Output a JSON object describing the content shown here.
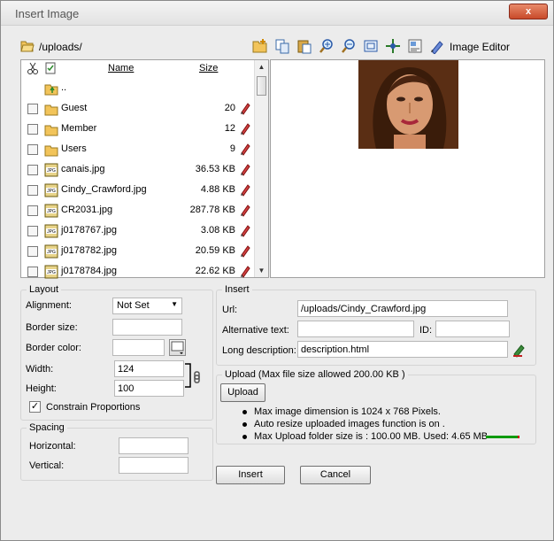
{
  "window": {
    "title": "Insert Image",
    "close_label": "x"
  },
  "path": {
    "current": "/uploads/"
  },
  "toolbar": {
    "icons": [
      "new-folder-icon",
      "copy-icon",
      "paste-icon",
      "zoom-in-icon",
      "zoom-out-icon",
      "actual-size-icon",
      "fit-icon",
      "properties-icon",
      "image-editor-icon"
    ],
    "image_editor_label": "Image Editor"
  },
  "file_list": {
    "header": {
      "name": "Name",
      "size": "Size"
    },
    "parent": "..",
    "rows": [
      {
        "name": "Guest",
        "size": "20",
        "type": "folder"
      },
      {
        "name": "Member",
        "size": "12",
        "type": "folder"
      },
      {
        "name": "Users",
        "size": "9",
        "type": "folder"
      },
      {
        "name": "canais.jpg",
        "size": "36.53 KB",
        "type": "jpg"
      },
      {
        "name": "Cindy_Crawford.jpg",
        "size": "4.88 KB",
        "type": "jpg"
      },
      {
        "name": "CR2031.jpg",
        "size": "287.78 KB",
        "type": "jpg"
      },
      {
        "name": "j0178767.jpg",
        "size": "3.08 KB",
        "type": "jpg"
      },
      {
        "name": "j0178782.jpg",
        "size": "20.59 KB",
        "type": "jpg"
      },
      {
        "name": "j0178784.jpg",
        "size": "22.62 KB",
        "type": "jpg"
      }
    ]
  },
  "layout": {
    "legend": "Layout",
    "alignment_label": "Alignment:",
    "alignment_value": "Not Set",
    "border_size_label": "Border size:",
    "border_size_value": "",
    "border_color_label": "Border color:",
    "border_color_value": "",
    "width_label": "Width:",
    "width_value": "124",
    "height_label": "Height:",
    "height_value": "100",
    "constrain_label": "Constrain Proportions",
    "constrain_checked": "✓"
  },
  "spacing": {
    "legend": "Spacing",
    "horizontal_label": "Horizontal:",
    "horizontal_value": "",
    "vertical_label": "Vertical:",
    "vertical_value": ""
  },
  "insert": {
    "legend": "Insert",
    "url_label": "Url:",
    "url_value": "/uploads/Cindy_Crawford.jpg",
    "alt_label": "Alternative text:",
    "alt_value": "",
    "id_label": "ID:",
    "id_value": "",
    "longdesc_label": "Long description:",
    "longdesc_value": "description.html"
  },
  "upload": {
    "legend": "Upload (Max file size allowed 200.00 KB )",
    "button_label": "Upload",
    "bullets": [
      "Max image dimension is 1024 x 768 Pixels.",
      "Auto resize uploaded images function is on .",
      "Max Upload folder size is : 100.00 MB. Used: 4.65 MB"
    ],
    "usage_fraction": 0.0465
  },
  "buttons": {
    "insert_label": "Insert",
    "cancel_label": "Cancel"
  },
  "colors": {
    "usage_bar": "#0a9a0a",
    "folder": "#f2c45a",
    "pencil": "#c02020"
  }
}
